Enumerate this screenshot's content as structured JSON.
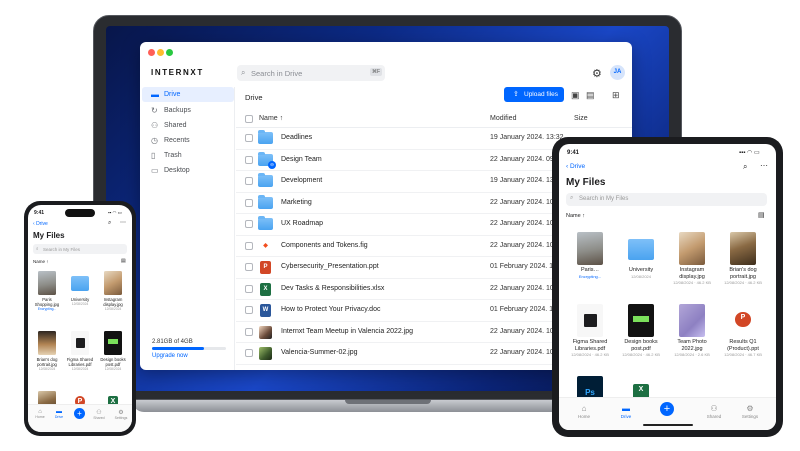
{
  "laptop": {
    "brand": "INTERNXT",
    "search_placeholder": "Search in Drive",
    "search_shortcut": "⌘F",
    "avatar_initials": "JA",
    "sidebar": {
      "items": [
        {
          "label": "Drive",
          "icon": "folder-icon",
          "active": true
        },
        {
          "label": "Backups",
          "icon": "backup-icon",
          "active": false
        },
        {
          "label": "Shared",
          "icon": "shared-icon",
          "active": false
        },
        {
          "label": "Recents",
          "icon": "clock-icon",
          "active": false
        },
        {
          "label": "Trash",
          "icon": "trash-icon",
          "active": false
        },
        {
          "label": "Desktop",
          "icon": "desktop-icon",
          "active": false
        }
      ],
      "storage_text": "2.81GB of 4GB",
      "storage_fraction": 0.7,
      "upgrade_label": "Upgrade now"
    },
    "breadcrumb": "Drive",
    "upload_label": "Upload files",
    "columns": {
      "name": "Name",
      "sort_arrow": "↑",
      "modified": "Modified",
      "size": "Size"
    },
    "files": [
      {
        "name": "Deadlines",
        "modified": "19 January 2024. 13:32",
        "kind": "folder"
      },
      {
        "name": "Design Team",
        "modified": "22 January 2024. 09:29",
        "kind": "folder-shared"
      },
      {
        "name": "Development",
        "modified": "19 January 2024. 13:32",
        "kind": "folder"
      },
      {
        "name": "Marketing",
        "modified": "22 January 2024. 10:08",
        "kind": "folder"
      },
      {
        "name": "UX Roadmap",
        "modified": "22 January 2024. 10:08",
        "kind": "folder"
      },
      {
        "name": "Components and Tokens.fig",
        "modified": "22 January 2024. 10:08",
        "kind": "fig"
      },
      {
        "name": "Cybersecurity_Presentation.ppt",
        "modified": "01 February 2024. 12:33",
        "kind": "ppt"
      },
      {
        "name": "Dev Tasks & Responsibilities.xlsx",
        "modified": "22 January 2024. 10:08",
        "kind": "xlsx"
      },
      {
        "name": "How to Protect Your Privacy.doc",
        "modified": "01 February 2024. 12:33",
        "kind": "doc"
      },
      {
        "name": "Internxt Team Meetup in Valencia 2022.jpg",
        "modified": "22 January 2024. 10:08",
        "kind": "photo"
      },
      {
        "name": "Valencia-Summer-02.jpg",
        "modified": "22 January 2024. 10:08",
        "kind": "photo"
      }
    ]
  },
  "tablet": {
    "time": "9:41",
    "status": "▪▪▪ ◠ ▭",
    "back_label": "Drive",
    "title": "My Files",
    "search_placeholder": "Search in My Files",
    "sort_label": "Name",
    "sort_arrow": "↑",
    "items": [
      {
        "name": "Paris…",
        "meta": "Encrypting...",
        "art": "paris",
        "encrypting": true
      },
      {
        "name": "University",
        "meta": "12/08/2024",
        "art": "folder"
      },
      {
        "name": "Instagram display.jpg",
        "meta": "12/08/2024 · 46.2 KB",
        "art": "insta"
      },
      {
        "name": "Brian's dog portrait.jpg",
        "meta": "12/08/2024 · 46.2 KB",
        "art": "dog"
      },
      {
        "name": "Figma Shared Libraries.pdf",
        "meta": "12/08/2024 · 46.2 KB",
        "art": "figma"
      },
      {
        "name": "Design books post.pdf",
        "meta": "12/08/2024 · 46.2 KB",
        "art": "book"
      },
      {
        "name": "Team Photo 2022.jpg",
        "meta": "12/08/2024 · 2.6 KB",
        "art": "team"
      },
      {
        "name": "Results Q1 (Product).ppt",
        "meta": "12/08/2024 · 46.7 KB",
        "art": "ppt"
      },
      {
        "name": "",
        "meta": "",
        "art": "ps"
      },
      {
        "name": "",
        "meta": "",
        "art": "xls"
      }
    ],
    "tabs": [
      {
        "label": "Home",
        "icon": "home-icon",
        "active": false
      },
      {
        "label": "Drive",
        "icon": "folder-icon",
        "active": true
      },
      {
        "label": "Shared",
        "icon": "shared-icon",
        "active": false
      },
      {
        "label": "Settings",
        "icon": "gear-icon",
        "active": false
      }
    ]
  },
  "phone": {
    "time": "9:41",
    "status": "▪▪ ◠ ▭",
    "back_label": "Drive",
    "title": "My Files",
    "search_placeholder": "Search in My Files",
    "sort_label": "Name",
    "sort_arrow": "↑",
    "items": [
      {
        "name": "Paris Shopping.jpg",
        "meta": "Encrypting...",
        "art": "paris"
      },
      {
        "name": "University",
        "meta": "12/08/2024",
        "art": "folder"
      },
      {
        "name": "Instagram display.jpg",
        "meta": "12/08/2024",
        "art": "insta"
      },
      {
        "name": "Brian's dog portrait.jpg",
        "meta": "12/08/2024",
        "art": "dog2"
      },
      {
        "name": "Figma Shared Libraries.pdf",
        "meta": "12/08/2024",
        "art": "figma"
      },
      {
        "name": "Design books post.pdf",
        "meta": "12/08/2024",
        "art": "book"
      },
      {
        "name": "",
        "meta": "",
        "art": "dog"
      },
      {
        "name": "",
        "meta": "",
        "art": "ppt"
      },
      {
        "name": "",
        "meta": "",
        "art": "xls"
      }
    ],
    "tabs": [
      {
        "label": "Home",
        "icon": "home-icon"
      },
      {
        "label": "Drive",
        "icon": "folder-icon"
      },
      {
        "label": "Shared",
        "icon": "shared-icon"
      },
      {
        "label": "Settings",
        "icon": "gear-icon"
      }
    ]
  }
}
